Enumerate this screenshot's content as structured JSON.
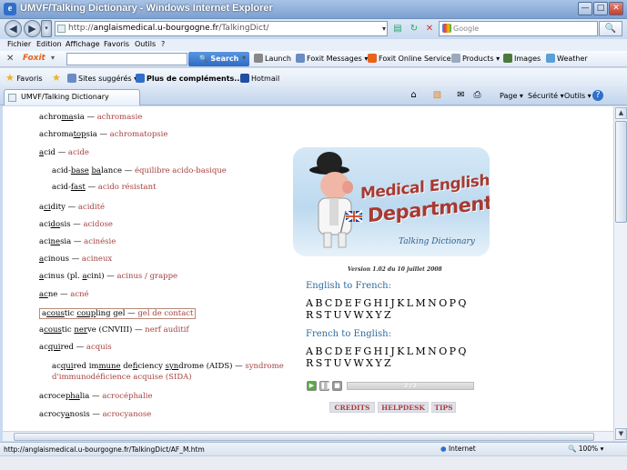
{
  "window": {
    "title": "UMVF/Talking Dictionary - Windows Internet Explorer"
  },
  "address": {
    "url_prefix": "http://",
    "url_host": "anglaismedical.u-bourgogne.fr",
    "url_path": "/TalkingDict/"
  },
  "search": {
    "placeholder": "Google"
  },
  "menu": [
    "Fichier",
    "Edition",
    "Affichage",
    "Favoris",
    "Outils",
    "?"
  ],
  "foxit": {
    "logo": "Foxit",
    "search_label": "Search",
    "items": [
      "Launch",
      "Foxit Messages",
      "Foxit Online Services",
      "Products",
      "Images",
      "Weather"
    ]
  },
  "favorites": {
    "favoris_label": "Favoris",
    "items": [
      "Sites suggérés",
      "Plus de compléments...",
      "Hotmail"
    ]
  },
  "tab": {
    "label": "UMVF/Talking Dictionary"
  },
  "commands": {
    "page": "Page",
    "securite": "Sécurité",
    "outils": "Outils"
  },
  "entries": [
    {
      "pre": "achro",
      "u": "ma",
      "post": "sia",
      "fr": "achromasie"
    },
    {
      "pre": "achroma",
      "u": "top",
      "post": "sia",
      "fr": "achromatopsie"
    },
    {
      "pre": "",
      "u": "a",
      "post": "cid",
      "fr": "acide"
    },
    {
      "pre": "acid-",
      "u": "base",
      "post": " ",
      "u2": "ba",
      "post2": "lance",
      "fr": "équilibre acido-basique"
    },
    {
      "pre": "acid-",
      "u": "fast",
      "post": "",
      "fr": "acido résistant"
    },
    {
      "pre": "a",
      "u": "ci",
      "post": "dity",
      "fr": "acidité"
    },
    {
      "pre": "aci",
      "u": "do",
      "post": "sis",
      "fr": "acidose"
    },
    {
      "pre": "aci",
      "u": "ne",
      "post": "sia",
      "fr": "acinésie"
    },
    {
      "pre": "",
      "u": "a",
      "post": "cinous",
      "fr": "acineux"
    },
    {
      "pre": "",
      "u": "a",
      "post": "cinus (pl. ",
      "u2": "a",
      "post2": "cini)",
      "fr": "acinus / grappe"
    },
    {
      "pre": "",
      "u": "ac",
      "post": "ne",
      "fr": "acné"
    },
    {
      "pre": "a",
      "u": "cous",
      "post": "tic ",
      "u2": "coup",
      "post2": "ling gel",
      "fr": "gel de contact"
    },
    {
      "pre": "a",
      "u": "cous",
      "post": "tic ",
      "u2": "ner",
      "post2": "ve (CNVIII)",
      "fr": "nerf auditif"
    },
    {
      "pre": "ac",
      "u": "qui",
      "post": "red",
      "fr": "acquis"
    },
    {
      "pre": "ac",
      "u": "qui",
      "post": "red im",
      "u2": "mune",
      "post2": " de",
      "u3": "fi",
      "post3": "ciency ",
      "u4": "syn",
      "post4": "drome (AIDS)",
      "fr": "syndrome d'immunodéficience acquise (SIDA)"
    },
    {
      "pre": "acroce",
      "u": "pha",
      "post": "lia",
      "fr": "acrocéphalie"
    },
    {
      "pre": "acrocy",
      "u": "a",
      "post": "nosis",
      "fr": "acrocyanose"
    }
  ],
  "dash": " — ",
  "banner": {
    "line1": "Medical English",
    "line2": "Department",
    "subtitle": "Talking Dictionary"
  },
  "version": "Version 1.02 du 10 juillet 2008",
  "eng_fr_heading": "English to French:",
  "fr_eng_heading": "French to English:",
  "letters_row1": [
    "A",
    "B",
    "C",
    "D",
    "E",
    "F",
    "G",
    "H",
    "I",
    "J",
    "K",
    "L",
    "M",
    "N",
    "O",
    "P",
    "Q"
  ],
  "letters_row2": [
    "R",
    "S",
    "T",
    "U",
    "V",
    "W",
    "X",
    "Y",
    "Z"
  ],
  "player_counter": "2 / 2",
  "links": [
    "CREDITS",
    "HELPDESK",
    "TIPS"
  ],
  "status": {
    "url": "http://anglaismedical.u-bourgogne.fr/TalkingDict/AF_M.htm",
    "zone": "Internet",
    "zoom": "100%"
  }
}
